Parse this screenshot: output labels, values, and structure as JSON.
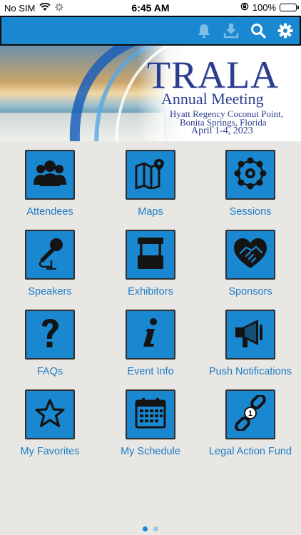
{
  "status_bar": {
    "carrier": "No SIM",
    "time": "6:45 AM",
    "battery": "100%",
    "battery_level": 1.0
  },
  "toolbar": {
    "accent": "#1a88d0",
    "icons": [
      "bell-icon",
      "download-icon",
      "search-icon",
      "gear-icon"
    ]
  },
  "banner": {
    "title": "TRALA",
    "subtitle": "Annual Meeting",
    "venue_line1": "Hyatt Regency Coconut Point,",
    "venue_line2": "Bonita Springs, Florida",
    "dates": "April 1-4, 2023"
  },
  "menu": {
    "items": [
      {
        "label": "Attendees",
        "icon": "people-icon"
      },
      {
        "label": "Maps",
        "icon": "map-icon"
      },
      {
        "label": "Sessions",
        "icon": "network-icon"
      },
      {
        "label": "Speakers",
        "icon": "microphone-icon"
      },
      {
        "label": "Exhibitors",
        "icon": "booth-icon"
      },
      {
        "label": "Sponsors",
        "icon": "heart-handshake-icon"
      },
      {
        "label": "FAQs",
        "icon": "question-icon"
      },
      {
        "label": "Event Info",
        "icon": "info-icon"
      },
      {
        "label": "Push Notifications",
        "icon": "megaphone-icon"
      },
      {
        "label": "My Favorites",
        "icon": "star-icon"
      },
      {
        "label": "My Schedule",
        "icon": "calendar-icon"
      },
      {
        "label": "Legal Action Fund",
        "icon": "chain-link-icon"
      }
    ]
  },
  "pagination": {
    "current_page": 1,
    "total_pages": 2
  }
}
